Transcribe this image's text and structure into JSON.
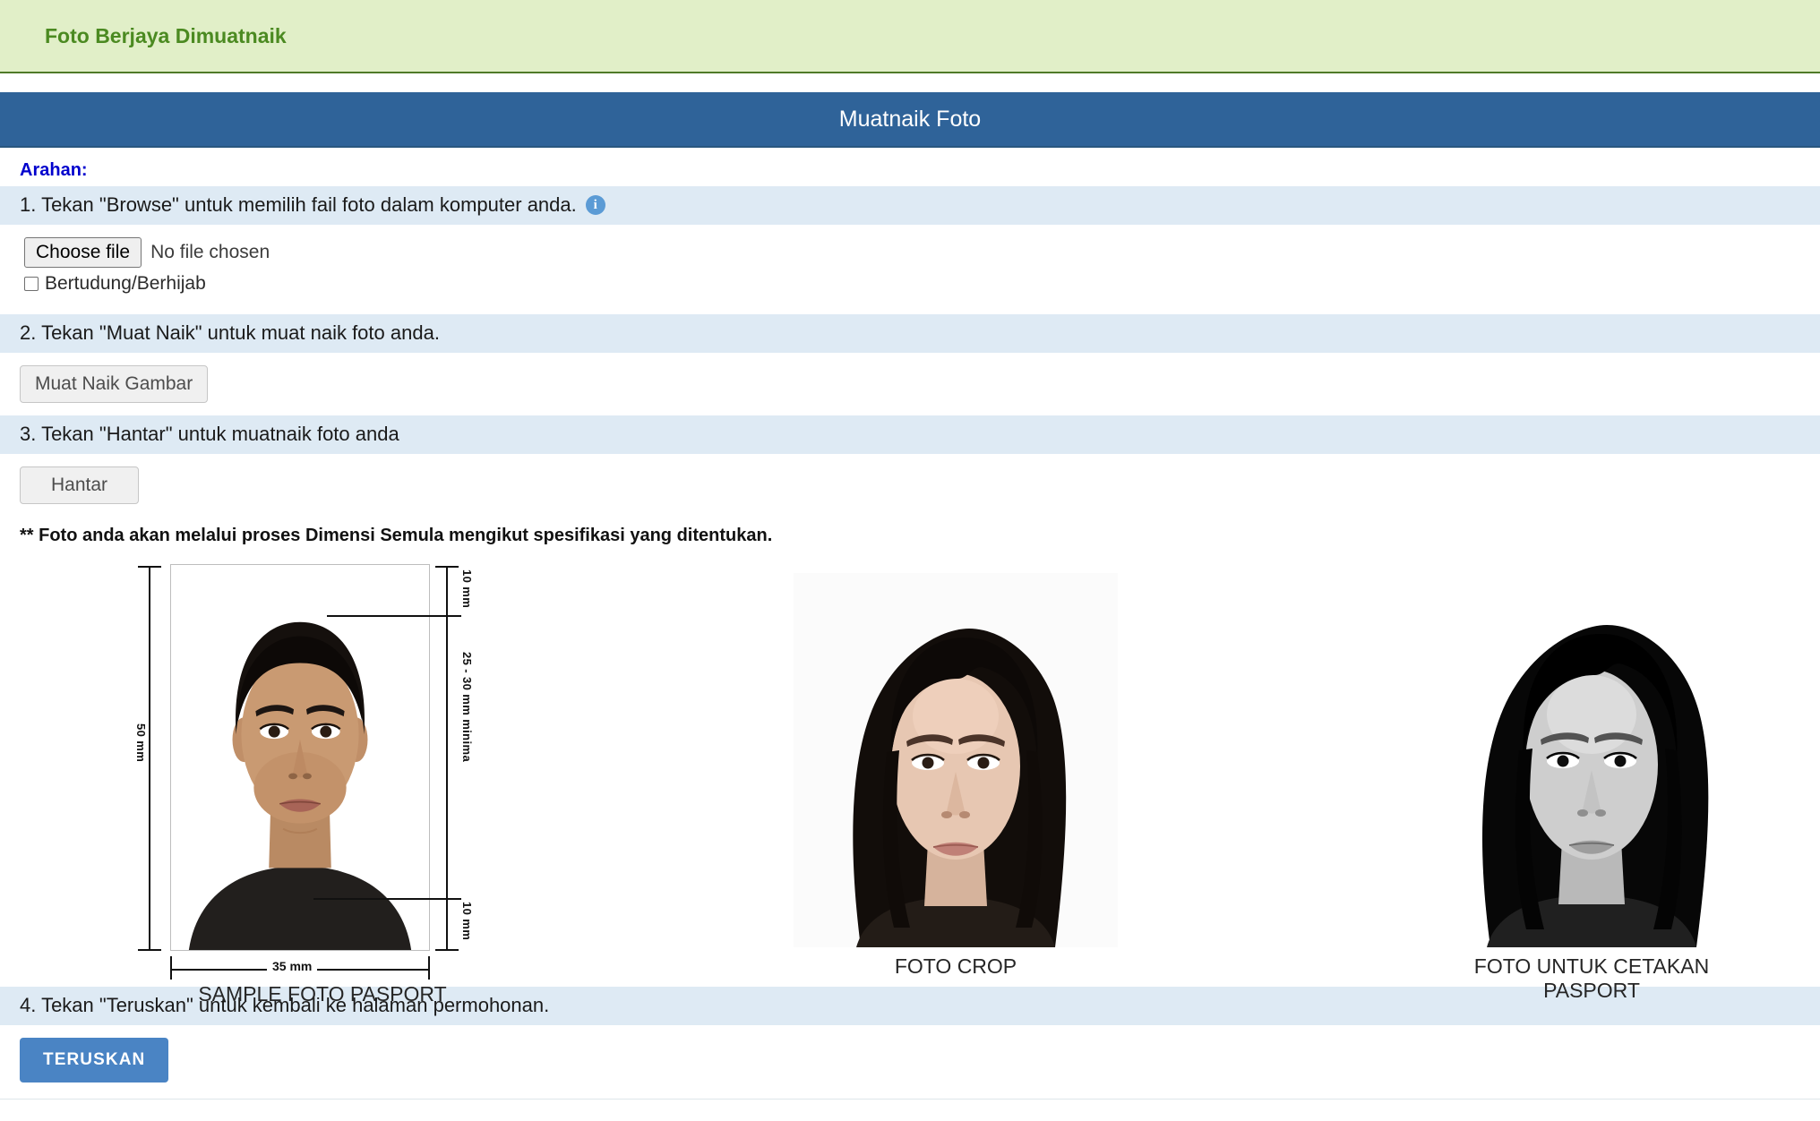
{
  "banner": {
    "message": "Foto Berjaya Dimuatnaik",
    "background_color": "#E1EFC8",
    "text_color": "#4B8A21"
  },
  "titlebar": {
    "title": "Muatnaik Foto",
    "background_color": "#2F6399"
  },
  "instructions": {
    "heading": "Arahan:",
    "step1": "1. Tekan \"Browse\" untuk memilih fail foto dalam komputer anda.",
    "step1_info_icon": "info-icon",
    "step2": "2. Tekan \"Muat Naik\" untuk muat naik foto anda.",
    "step3": "3. Tekan \"Hantar\" untuk muatnaik foto anda",
    "step4": "4. Tekan \"Teruskan\" untuk kembali ke halaman permohonan.",
    "row_background_color": "#DEEAF4"
  },
  "file_input": {
    "button_label": "Choose file",
    "status_text": "No file chosen"
  },
  "hijab_checkbox": {
    "label": "Bertudung/Berhijab",
    "checked": false
  },
  "upload_button": {
    "label": "Muat Naik Gambar"
  },
  "submit_button": {
    "label": "Hantar"
  },
  "note": "** Foto anda akan melalui proses Dimensi Semula mengikut spesifikasi yang ditentukan.",
  "photos": {
    "sample": {
      "caption": "SAMPLE FOTO PASPORT",
      "dimensions": {
        "height": "50 mm",
        "width": "35 mm",
        "top_margin": "10 mm",
        "face_height": "25 - 30 mm minima",
        "bottom_margin": "10 mm"
      }
    },
    "crop": {
      "caption": "FOTO CROP"
    },
    "print": {
      "caption": "FOTO UNTUK CETAKAN PASPORT"
    }
  },
  "continue_button": {
    "label": "TERUSKAN",
    "background_color": "#4A84C4"
  }
}
